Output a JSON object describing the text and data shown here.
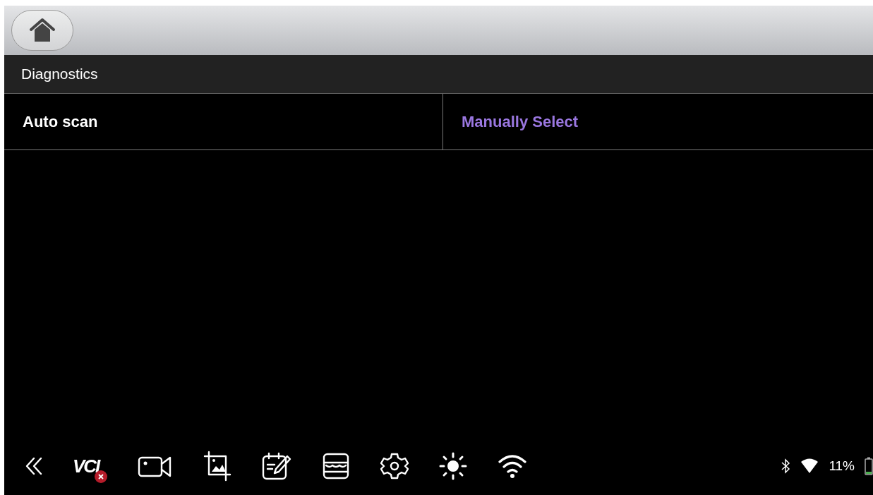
{
  "header": {
    "title": "Diagnostics"
  },
  "tabs": [
    {
      "label": "Auto scan",
      "selected": false
    },
    {
      "label": "Manually Select",
      "selected": true
    }
  ],
  "status_bar": {
    "vci": "VCI",
    "battery": "11%"
  }
}
